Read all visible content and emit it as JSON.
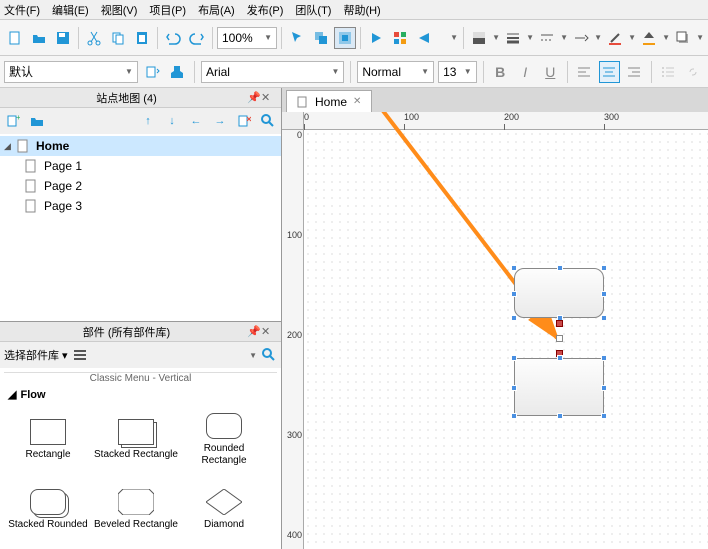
{
  "menu": [
    "文件(F)",
    "编辑(E)",
    "视图(V)",
    "项目(P)",
    "布局(A)",
    "发布(P)",
    "团队(T)",
    "帮助(H)"
  ],
  "toolbar": {
    "zoom": "100%",
    "style": "默认",
    "font": "Arial",
    "paragraph": "Normal",
    "size": "13"
  },
  "sitemap": {
    "title": "站点地图 (4)",
    "root": "Home",
    "pages": [
      "Page 1",
      "Page 2",
      "Page 3"
    ]
  },
  "widgets": {
    "title": "部件 (所有部件库)",
    "selector": "选择部件库 ▾",
    "truncated": "Classic Menu - Vertical",
    "category": "Flow",
    "items": [
      "Rectangle",
      "Stacked Rectangle",
      "Rounded Rectangle",
      "Stacked Rounded",
      "Beveled Rectangle",
      "Diamond"
    ]
  },
  "tab": {
    "label": "Home"
  },
  "ruler_h": [
    0,
    100,
    200,
    300
  ],
  "ruler_v": [
    0,
    100,
    200,
    300,
    400
  ],
  "colors": {
    "accent": "#2196d6",
    "select": "#cce8ff"
  }
}
